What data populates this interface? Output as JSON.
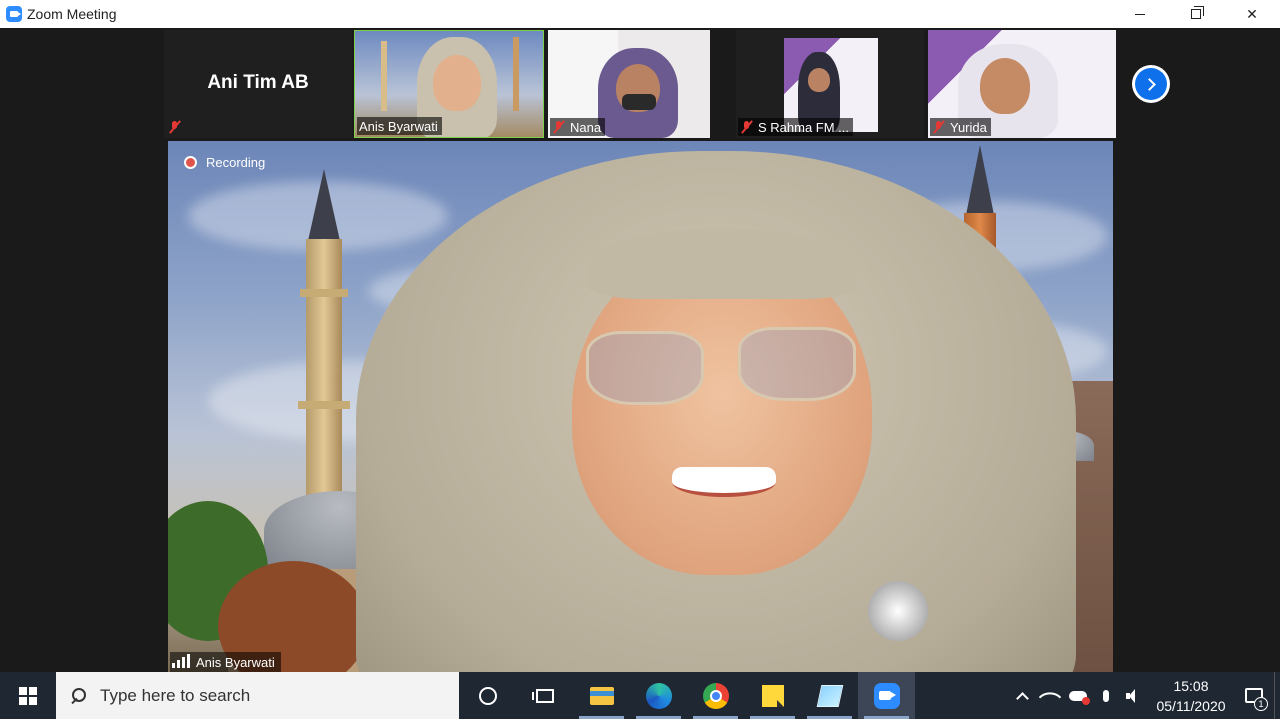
{
  "window": {
    "title": "Zoom Meeting"
  },
  "strip": {
    "tiles": [
      {
        "name": "Ani Tim AB",
        "muted": true,
        "video": false
      },
      {
        "name": "Anis Byarwati",
        "muted": false,
        "video": true
      },
      {
        "name": "Nana",
        "muted": true,
        "video": true
      },
      {
        "name": "S Rahma FM ...",
        "muted": true,
        "video": true
      },
      {
        "name": "Yurida",
        "muted": true,
        "video": true
      }
    ]
  },
  "main": {
    "recording_label": "Recording",
    "speaker_name": "Anis Byarwati"
  },
  "taskbar": {
    "search_placeholder": "Type here to search",
    "apps": [
      "cortana-icon",
      "task-view-icon",
      "file-explorer-icon",
      "edge-icon",
      "chrome-icon",
      "sticky-notes-icon",
      "app-icon",
      "zoom-icon"
    ],
    "time": "15:08",
    "date": "05/11/2020",
    "notification_count": "1"
  },
  "colors": {
    "zoom_blue": "#2d8cff",
    "muted_red": "#e53935",
    "active_border": "#7bd148"
  }
}
